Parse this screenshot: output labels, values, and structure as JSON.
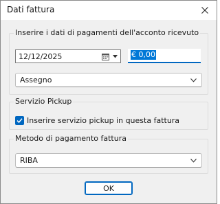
{
  "window": {
    "title": "Dati fattura"
  },
  "payment_group": {
    "label": "Inserire i dati di pagamenti dell'acconto ricevuto",
    "date_value": "12/12/2025",
    "amount_value": "€ 0,00",
    "method_value": "Assegno"
  },
  "pickup_group": {
    "label": "Servizio Pickup",
    "checkbox_label": "Inserire servizio pickup in questa fattura",
    "checked": true
  },
  "invoice_method_group": {
    "label": "Metodo di pagamento fattura",
    "method_value": "RIBA"
  },
  "actions": {
    "ok_label": "OK"
  },
  "colors": {
    "accent": "#0067c0",
    "selection": "#0078d7",
    "dialog_bg": "#f0f0f0"
  }
}
